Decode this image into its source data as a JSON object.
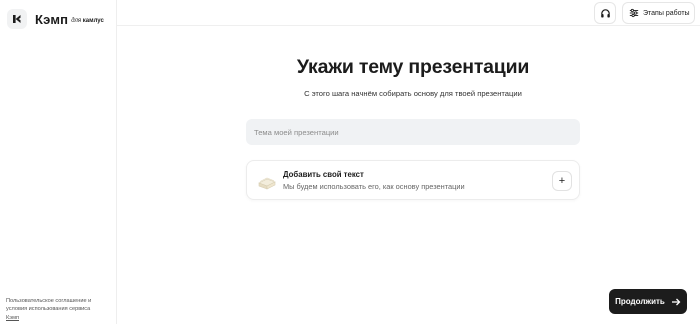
{
  "brand": {
    "name": "Кэмп",
    "sub_prefix": "для",
    "sub_name": "камлус"
  },
  "footer": {
    "legal_text": "Пользовательское соглашение и условия использования сервиса",
    "legal_link": "Кэмп"
  },
  "header": {
    "support_icon": "headphones-icon",
    "stages_label": "Этапы работы",
    "stages_icon": "sliders-icon"
  },
  "main": {
    "title": "Укажи тему презентации",
    "subtitle": "С этого шага начнём собирать основу для твоей презентации",
    "topic_input": {
      "value": "",
      "placeholder": "Тема моей презентации"
    },
    "add_text_card": {
      "title": "Добавить свой текст",
      "description": "Мы будем использовать его, как основу презентации",
      "button_icon": "plus-icon",
      "button_label": "+"
    }
  },
  "actions": {
    "continue_label": "Продолжить",
    "continue_icon": "arrow-right-icon"
  },
  "colors": {
    "primary_button": "#1c1c1c",
    "input_background": "#f0f2f4",
    "border": "#ececec"
  }
}
